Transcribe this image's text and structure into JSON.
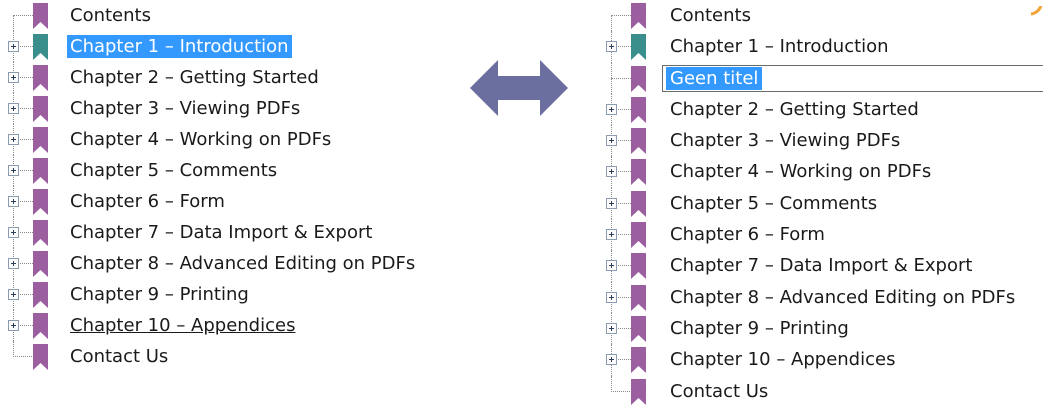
{
  "left_panel": {
    "items": [
      {
        "label": "Contents",
        "expandable": false,
        "icon": "bookmark-icon",
        "icon_color": "#9b5fa0"
      },
      {
        "label": "Chapter 1 – Introduction",
        "expandable": true,
        "selected": true,
        "icon": "bookmark-icon",
        "icon_color": "#3a8f8c"
      },
      {
        "label": "Chapter 2 – Getting Started",
        "expandable": true,
        "icon": "bookmark-icon",
        "icon_color": "#9b5fa0"
      },
      {
        "label": "Chapter 3 – Viewing PDFs",
        "expandable": true,
        "icon": "bookmark-icon",
        "icon_color": "#9b5fa0"
      },
      {
        "label": "Chapter 4 – Working on PDFs",
        "expandable": true,
        "icon": "bookmark-icon",
        "icon_color": "#9b5fa0"
      },
      {
        "label": "Chapter 5 – Comments",
        "expandable": true,
        "icon": "bookmark-icon",
        "icon_color": "#9b5fa0"
      },
      {
        "label": "Chapter 6 – Form",
        "expandable": true,
        "icon": "bookmark-icon",
        "icon_color": "#9b5fa0"
      },
      {
        "label": "Chapter 7 – Data Import & Export",
        "expandable": true,
        "icon": "bookmark-icon",
        "icon_color": "#9b5fa0"
      },
      {
        "label": "Chapter 8 – Advanced Editing on PDFs",
        "expandable": true,
        "icon": "bookmark-icon",
        "icon_color": "#9b5fa0"
      },
      {
        "label": "Chapter 9 – Printing",
        "expandable": true,
        "icon": "bookmark-icon",
        "icon_color": "#9b5fa0"
      },
      {
        "label": "Chapter 10 – Appendices",
        "expandable": true,
        "underlined": true,
        "icon": "bookmark-icon",
        "icon_color": "#9b5fa0"
      },
      {
        "label": "Contact Us",
        "expandable": false,
        "icon": "bookmark-icon",
        "icon_color": "#9b5fa0"
      }
    ]
  },
  "right_panel": {
    "items": [
      {
        "label": "Contents",
        "expandable": false,
        "icon": "bookmark-icon",
        "icon_color": "#9b5fa0"
      },
      {
        "label": "Chapter 1 – Introduction",
        "expandable": true,
        "icon": "bookmark-icon",
        "icon_color": "#3a8f8c"
      },
      {
        "label": "Geen titel",
        "expandable": false,
        "editing": true,
        "icon": "bookmark-icon",
        "icon_color": "#9b5fa0"
      },
      {
        "label": "Chapter 2 – Getting Started",
        "expandable": true,
        "icon": "bookmark-icon",
        "icon_color": "#9b5fa0"
      },
      {
        "label": "Chapter 3 – Viewing PDFs",
        "expandable": true,
        "icon": "bookmark-icon",
        "icon_color": "#9b5fa0"
      },
      {
        "label": "Chapter 4 – Working on PDFs",
        "expandable": true,
        "icon": "bookmark-icon",
        "icon_color": "#9b5fa0"
      },
      {
        "label": "Chapter 5 – Comments",
        "expandable": true,
        "icon": "bookmark-icon",
        "icon_color": "#9b5fa0"
      },
      {
        "label": "Chapter 6 – Form",
        "expandable": true,
        "icon": "bookmark-icon",
        "icon_color": "#9b5fa0"
      },
      {
        "label": "Chapter 7 – Data Import & Export",
        "expandable": true,
        "icon": "bookmark-icon",
        "icon_color": "#9b5fa0"
      },
      {
        "label": "Chapter 8 – Advanced Editing on PDFs",
        "expandable": true,
        "icon": "bookmark-icon",
        "icon_color": "#9b5fa0"
      },
      {
        "label": "Chapter 9 – Printing",
        "expandable": true,
        "icon": "bookmark-icon",
        "icon_color": "#9b5fa0"
      },
      {
        "label": "Chapter 10 – Appendices",
        "expandable": true,
        "icon": "bookmark-icon",
        "icon_color": "#9b5fa0"
      },
      {
        "label": "Contact Us",
        "expandable": false,
        "icon": "bookmark-icon",
        "icon_color": "#9b5fa0"
      }
    ]
  },
  "arrow": {
    "icon": "double-arrow-icon",
    "color": "#6a6fa0"
  },
  "colors": {
    "selection": "#3399ff",
    "tree_line": "#8a8a8a"
  }
}
